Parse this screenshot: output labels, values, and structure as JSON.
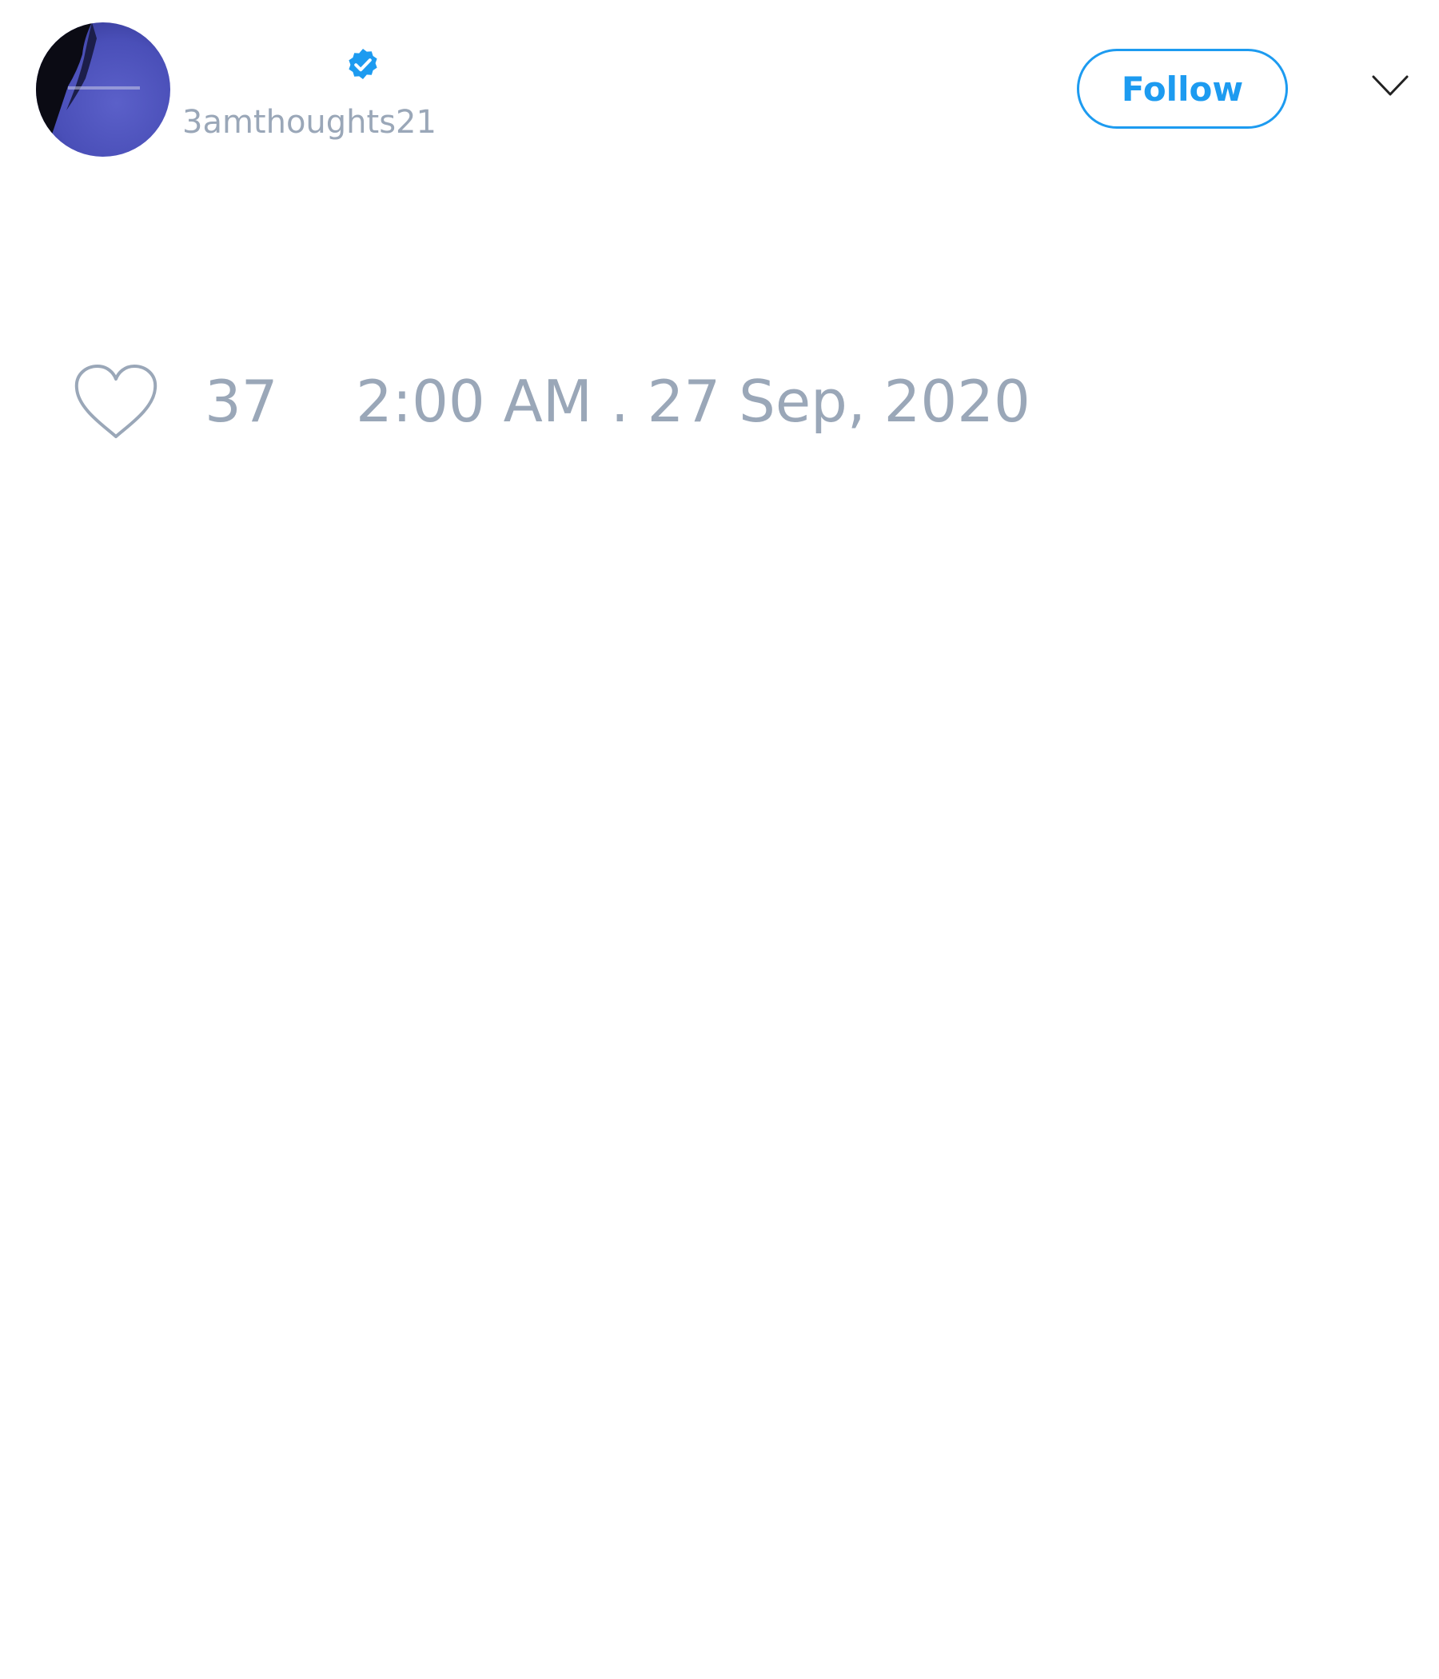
{
  "tweet": {
    "author": {
      "display_name": "",
      "handle": "3amthoughts21",
      "verified": true,
      "avatar_icon": "avatar-photo"
    },
    "follow_button_label": "Follow",
    "menu_icon": "chevron-down-icon",
    "like_icon": "heart-icon",
    "like_count": "37",
    "timestamp": "2:00 AM . 27 Sep, 2020"
  },
  "colors": {
    "accent": "#1d9bf0",
    "muted_text": "#9aa7b8",
    "background": "#ffffff"
  }
}
